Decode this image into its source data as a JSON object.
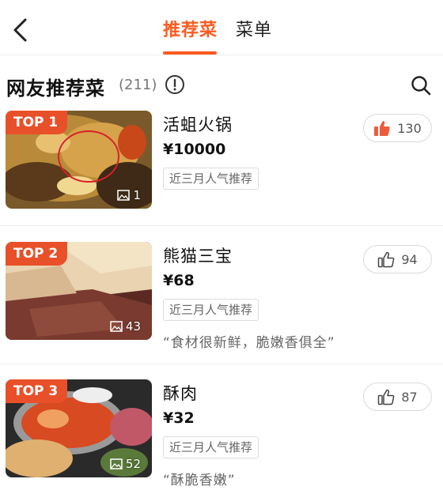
{
  "header": {
    "tabs": [
      {
        "label": "推荐菜",
        "active": true
      },
      {
        "label": "菜单",
        "active": false
      }
    ]
  },
  "section": {
    "title": "网友推荐菜",
    "count": "(211)"
  },
  "colors": {
    "accent": "#ff5a1f",
    "badge": "#e8502a",
    "liked": "#f05a3a"
  },
  "dishes": [
    {
      "badge": "TOP 1",
      "name": "活蛆火锅",
      "price": "¥10000",
      "tag": "近三月人气推荐",
      "quote": "",
      "photos": "1",
      "likes": "130",
      "liked": true
    },
    {
      "badge": "TOP 2",
      "name": "熊猫三宝",
      "price": "¥68",
      "tag": "近三月人气推荐",
      "quote": "“食材很新鲜，脆嫩香俱全”",
      "photos": "43",
      "likes": "94",
      "liked": false
    },
    {
      "badge": "TOP 3",
      "name": "酥肉",
      "price": "¥32",
      "tag": "近三月人气推荐",
      "quote": "“酥脆香嫩”",
      "photos": "52",
      "likes": "87",
      "liked": false
    }
  ]
}
